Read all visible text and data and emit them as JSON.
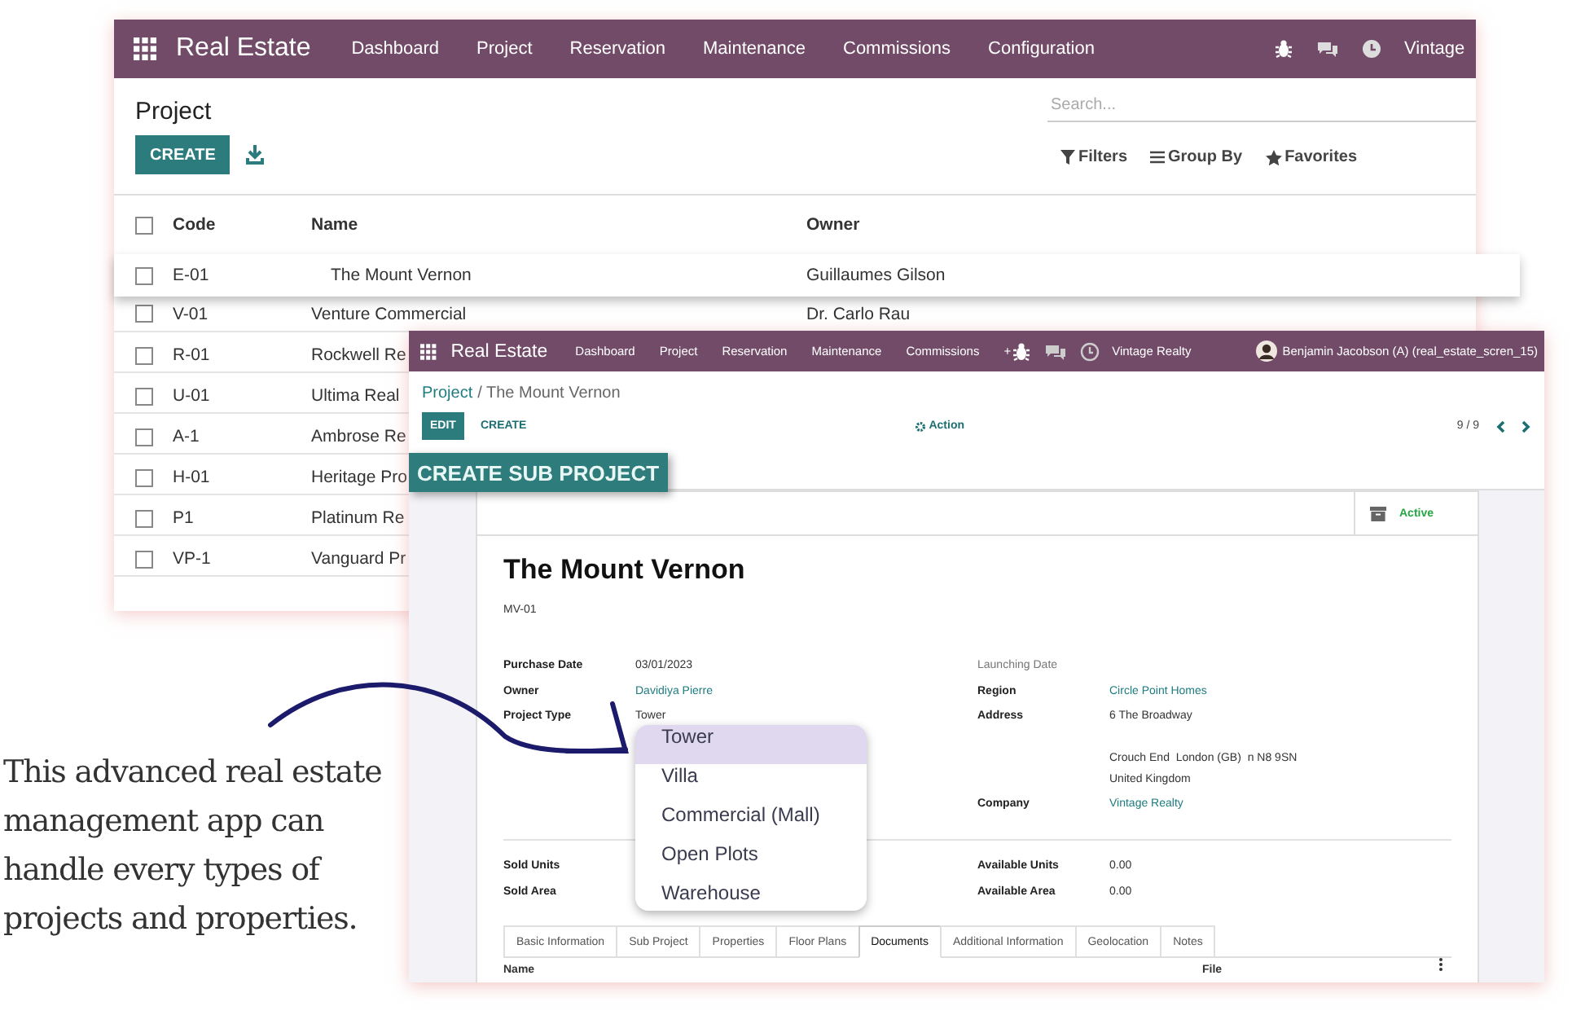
{
  "caption": "This advanced real estate management app can handle every types of projects and properties.",
  "list_window": {
    "app_name": "Real Estate",
    "menu": [
      "Dashboard",
      "Project",
      "Reservation",
      "Maintenance",
      "Commissions",
      "Configuration"
    ],
    "company": "Vintage",
    "title": "Project",
    "create_button": "CREATE",
    "search": {
      "placeholder": "Search..."
    },
    "filters": [
      "Filters",
      "Group By",
      "Favorites"
    ],
    "all_checked": false,
    "columns": [
      "Code",
      "Name",
      "Owner"
    ],
    "rows": [
      {
        "code": "E-01",
        "name": "The Mount Vernon",
        "owner": "Guillaumes Gilson",
        "selected": true,
        "checked": false
      },
      {
        "code": "V-01",
        "name": "Venture Commercial",
        "owner": "Dr. Carlo Rau",
        "selected": false,
        "checked": false
      },
      {
        "code": "R-01",
        "name": "Rockwell Re",
        "selected": false,
        "checked": false
      },
      {
        "code": "U-01",
        "name": "Ultima Real",
        "selected": false,
        "checked": false
      },
      {
        "code": "A-1",
        "name": "Ambrose Re",
        "selected": false,
        "checked": false
      },
      {
        "code": "H-01",
        "name": "Heritage Pro",
        "selected": false,
        "checked": false
      },
      {
        "code": "P1",
        "name": "Platinum Re",
        "selected": false,
        "checked": false
      },
      {
        "code": "VP-1",
        "name": "Vanguard Pr",
        "selected": false,
        "checked": false
      }
    ]
  },
  "form_window": {
    "app_name": "Real Estate",
    "menu": [
      "Dashboard",
      "Project",
      "Reservation",
      "Maintenance",
      "Commissions",
      "+"
    ],
    "company": "Vintage Realty",
    "user": "Benjamin Jacobson (A) (real_estate_scren_15)",
    "breadcrumb": [
      {
        "label": "Project",
        "kind": "link"
      },
      {
        "label": "/ The Mount Vernon",
        "kind": "current"
      }
    ],
    "edit_button": "EDIT",
    "create_button": "CREATE",
    "action": "Action",
    "pager": "9 / 9",
    "sub_project_button": "CREATE SUB PROJECT",
    "status": "Active",
    "title": "The Mount Vernon",
    "code": "MV-01",
    "left_fields": [
      {
        "label": "Purchase Date",
        "value": "03/01/2023",
        "kind": "text"
      },
      {
        "label": "Owner",
        "value": "Davidiya Pierre",
        "kind": "link"
      },
      {
        "label": "Project Type",
        "value": "Tower",
        "kind": "text"
      }
    ],
    "right_fields": [
      {
        "label": "Launching Date",
        "kind": "empty"
      },
      {
        "label": "Region",
        "value": "Circle Point Homes",
        "kind": "link"
      },
      {
        "label": "Address",
        "value": "6 The Broadway",
        "kind": "text",
        "extra_lines": [
          "Crouch End  London (GB)  n N8 9SN",
          "United Kingdom"
        ]
      },
      {
        "label": "Company",
        "value": "Vintage Realty",
        "kind": "link"
      }
    ],
    "left_stats": [
      {
        "label": "Sold Units"
      },
      {
        "label": "Sold Area"
      }
    ],
    "right_stats": [
      {
        "label": "Available Units",
        "value": "0.00"
      },
      {
        "label": "Available Area",
        "value": "0.00"
      }
    ],
    "tabs": [
      {
        "label": "Basic Information",
        "selected": false
      },
      {
        "label": "Sub Project",
        "selected": false
      },
      {
        "label": "Properties",
        "selected": false
      },
      {
        "label": "Floor Plans",
        "selected": false
      },
      {
        "label": "Documents",
        "selected": true
      },
      {
        "label": "Additional Information",
        "selected": false
      },
      {
        "label": "Geolocation",
        "selected": false
      },
      {
        "label": "Notes",
        "selected": false
      }
    ],
    "table": {
      "columns": [
        "Name",
        "File"
      ]
    },
    "type_menu": [
      {
        "label": "Tower",
        "selected": true
      },
      {
        "label": "Villa",
        "selected": false
      },
      {
        "label": "Commercial (Mall)",
        "selected": false
      },
      {
        "label": "Open Plots",
        "selected": false
      },
      {
        "label": "Warehouse",
        "selected": false
      }
    ]
  }
}
